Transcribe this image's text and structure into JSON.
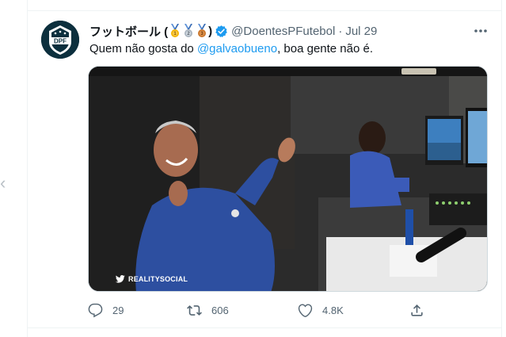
{
  "tweet": {
    "display_name": "フットボール (",
    "display_name_close": ")",
    "medals": [
      "gold-medal",
      "silver-medal",
      "bronze-medal"
    ],
    "handle": "@DoentesPFutebol",
    "separator": "·",
    "timestamp": "Jul 29",
    "text_before": "Quem não gosta do ",
    "mention": "@galvaobueno",
    "text_after": ", boa gente não é.",
    "media_watermark": "REALITYSOCIAL"
  },
  "avatar": {
    "label": "DPF"
  },
  "actions": {
    "reply_count": "29",
    "retweet_count": "606",
    "like_count": "4.8K"
  },
  "colors": {
    "accent": "#1d9bf0",
    "secondary_text": "#536471",
    "divider": "#eff3f4"
  },
  "icons": [
    "more-icon",
    "verified-icon",
    "reply-icon",
    "retweet-icon",
    "like-icon",
    "share-icon",
    "twitter-bird-icon"
  ]
}
